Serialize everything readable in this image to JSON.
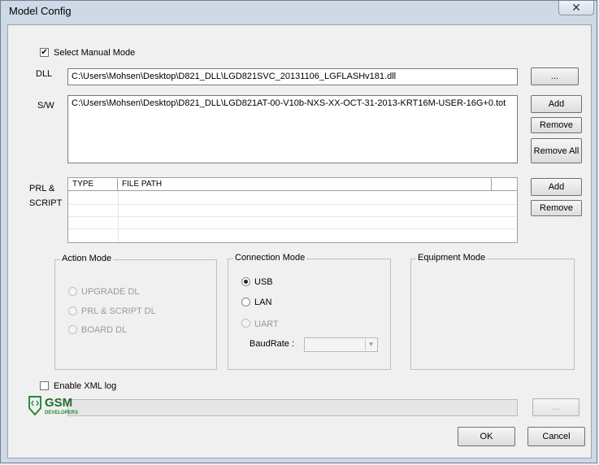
{
  "window": {
    "title": "Model Config",
    "close_glyph": "✕"
  },
  "manual_mode": {
    "label": "Select Manual Mode",
    "checked": true,
    "check_glyph": "✔"
  },
  "dll": {
    "label": "DLL",
    "value": "C:\\Users\\Mohsen\\Desktop\\D821_DLL\\LGD821SVC_20131106_LGFLASHv181.dll",
    "browse_label": "..."
  },
  "sw": {
    "label": "S/W",
    "value": "C:\\Users\\Mohsen\\Desktop\\D821_DLL\\LGD821AT-00-V10b-NXS-XX-OCT-31-2013-KRT16M-USER-16G+0.tot",
    "add_label": "Add",
    "remove_label": "Remove",
    "remove_all_label": "Remove All"
  },
  "prl": {
    "label_line1": "PRL  &",
    "label_line2": "SCRIPT",
    "columns": [
      "TYPE",
      "FILE PATH"
    ],
    "add_label": "Add",
    "remove_label": "Remove"
  },
  "action_mode": {
    "title": "Action Mode",
    "options": [
      "UPGRADE DL",
      "PRL & SCRIPT DL",
      "BOARD DL"
    ]
  },
  "connection_mode": {
    "title": "Connection Mode",
    "options": [
      "USB",
      "LAN",
      "UART"
    ],
    "selected": "USB",
    "baudrate_label": "BaudRate :",
    "arrow_glyph": "▼"
  },
  "equipment_mode": {
    "title": "Equipment Mode"
  },
  "xml_log": {
    "label": "Enable XML log",
    "checked": false
  },
  "progress": {
    "browse_label": "...",
    "value": 0
  },
  "footer": {
    "ok_label": "OK",
    "cancel_label": "Cancel"
  },
  "logo": {
    "brand": "GSM",
    "sub": "DEVELOPERS",
    "color": "#2a8a3a"
  }
}
